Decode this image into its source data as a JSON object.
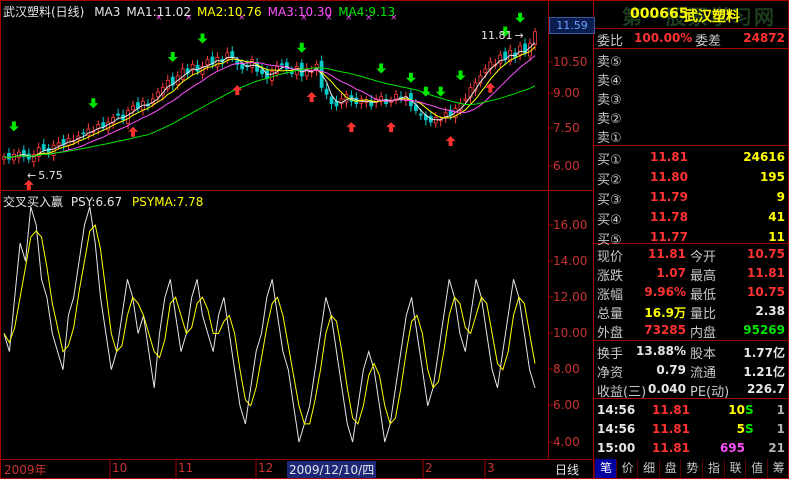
{
  "main_chart": {
    "title": "武汉塑料(日线)",
    "ma_labels": [
      {
        "text": "MA3",
        "color": "#e6e6e6"
      },
      {
        "text": "MA1:11.02",
        "color": "#e6e6e6"
      },
      {
        "text": "MA2:10.76",
        "color": "#ffff00"
      },
      {
        "text": "MA3:10.30",
        "color": "#ff50ff"
      },
      {
        "text": "MA4:9.13",
        "color": "#00e600"
      }
    ],
    "y_ticks": [
      "10.50",
      "9.00",
      "7.50",
      "6.00"
    ],
    "current_price_tag": "11.59",
    "high_label": "11.81",
    "low_label": "5.75"
  },
  "sub_chart": {
    "title": "交叉买入赢",
    "psy_label": "PSY:6.67",
    "psyma_label": "PSYMA:7.78",
    "y_ticks": [
      "16.00",
      "14.00",
      "12.00",
      "10.00",
      "8.00",
      "6.00",
      "4.00"
    ]
  },
  "time_axis": {
    "labels": [
      "2009年",
      "10",
      "11",
      "12",
      "2009/12/10/四",
      "2",
      "3"
    ],
    "period_button": "日线"
  },
  "quote_panel": {
    "stock_code": "000665",
    "stock_name": "武汉塑料",
    "watermark": "第一股票学习网",
    "wb_ratio_label": "委比",
    "wb_ratio_value": "100.00%",
    "wb_diff_label": "委差",
    "wb_diff_value": "24872",
    "sell_rows": [
      {
        "label": "卖⑤",
        "price": "",
        "volume": ""
      },
      {
        "label": "卖④",
        "price": "",
        "volume": ""
      },
      {
        "label": "卖③",
        "price": "",
        "volume": ""
      },
      {
        "label": "卖②",
        "price": "",
        "volume": ""
      },
      {
        "label": "卖①",
        "price": "",
        "volume": ""
      }
    ],
    "buy_rows": [
      {
        "label": "买①",
        "price": "11.81",
        "volume": "24616"
      },
      {
        "label": "买②",
        "price": "11.80",
        "volume": "195"
      },
      {
        "label": "买③",
        "price": "11.79",
        "volume": "9"
      },
      {
        "label": "买④",
        "price": "11.78",
        "volume": "41"
      },
      {
        "label": "买⑤",
        "price": "11.77",
        "volume": "11"
      }
    ],
    "stats": [
      {
        "l1": "现价",
        "v1": "11.81",
        "c1": "#ff3232",
        "l2": "今开",
        "v2": "10.75",
        "c2": "#ff3232"
      },
      {
        "l1": "涨跌",
        "v1": "1.07",
        "c1": "#ff3232",
        "l2": "最高",
        "v2": "11.81",
        "c2": "#ff3232"
      },
      {
        "l1": "涨幅",
        "v1": "9.96%",
        "c1": "#ff3232",
        "l2": "最低",
        "v2": "10.75",
        "c2": "#ff3232"
      },
      {
        "l1": "总量",
        "v1": "16.9万",
        "c1": "#ffff00",
        "l2": "量比",
        "v2": "2.38",
        "c2": "#e6e6e6"
      },
      {
        "l1": "外盘",
        "v1": "73285",
        "c1": "#ff3232",
        "l2": "内盘",
        "v2": "95269",
        "c2": "#00e600"
      }
    ],
    "fundamentals": [
      {
        "l1": "换手",
        "v1": "13.88%",
        "l2": "股本",
        "v2": "1.77亿"
      },
      {
        "l1": "净资",
        "v1": "0.79",
        "l2": "流通",
        "v2": "1.21亿"
      },
      {
        "l1": "收益(三)",
        "v1": "0.040",
        "l2": "PE(动)",
        "v2": "226.7"
      }
    ],
    "ticks": [
      {
        "time": "14:56",
        "price": "11.81",
        "vol": "10",
        "vol_color": "#ffff00",
        "side": "S",
        "count": "1"
      },
      {
        "time": "14:56",
        "price": "11.81",
        "vol": "5",
        "vol_color": "#ffff00",
        "side": "S",
        "count": "1"
      },
      {
        "time": "15:00",
        "price": "11.81",
        "vol": "695",
        "vol_color": "#ff50ff",
        "side": "",
        "count": "21"
      }
    ],
    "tabs": [
      "笔",
      "价",
      "细",
      "盘",
      "势",
      "指",
      "联",
      "值",
      "筹"
    ]
  }
}
